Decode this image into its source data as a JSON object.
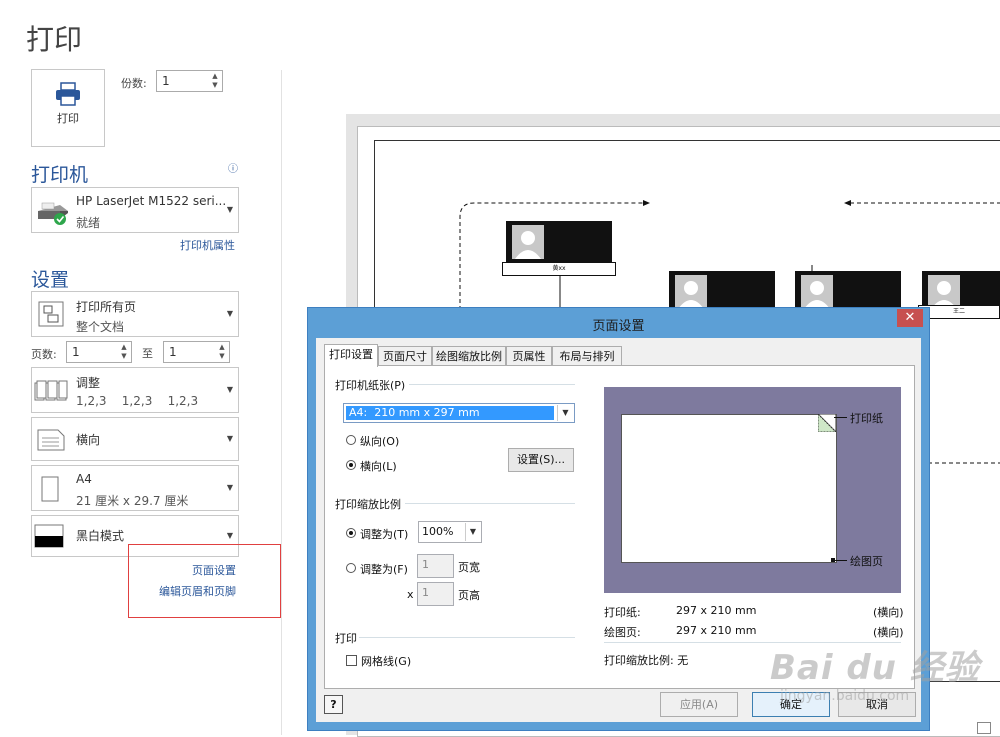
{
  "page": {
    "title": "打印"
  },
  "print_button": {
    "label": "打印"
  },
  "copies": {
    "label": "份数:",
    "value": "1"
  },
  "printer": {
    "heading": "打印机",
    "name": "HP LaserJet M1522 seri...",
    "status": "就绪",
    "properties_link": "打印机属性"
  },
  "settings": {
    "heading": "设置",
    "range": {
      "line1": "打印所有页",
      "line2": "整个文档"
    },
    "pages_label": "页数:",
    "pages_from": "1",
    "pages_to_label": "至",
    "pages_to": "1",
    "collate": {
      "line1": "调整",
      "line2": "1,2,3    1,2,3    1,2,3"
    },
    "orientation": {
      "line1": "横向"
    },
    "paper": {
      "line1": "A4",
      "line2": "21 厘米 x 29.7 厘米"
    },
    "color": {
      "line1": "黑白模式"
    },
    "page_setup_link": "页面设置",
    "header_footer_link": "编辑页眉和页脚"
  },
  "preview": {
    "node_top_name": "黄xx",
    "node_right_name": "王二"
  },
  "dialog": {
    "title": "页面设置",
    "close": "✕",
    "tabs": [
      "打印设置",
      "页面尺寸",
      "绘图缩放比例",
      "页属性",
      "布局与排列"
    ],
    "paper_group": "打印机纸张(P)",
    "paper_value": "A4:  210 mm x 297 mm",
    "portrait": "纵向(O)",
    "landscape": "横向(L)",
    "setup_button": "设置(S)...",
    "zoom_group": "打印缩放比例",
    "fit_to": "调整为(T)",
    "fit_value": "100%",
    "fit_pages": "调整为(F)",
    "pages_wide_value": "1",
    "pages_wide_label": "页宽",
    "x_label": "x",
    "pages_high_value": "1",
    "pages_high_label": "页高",
    "print_group": "打印",
    "gridlines": "网格线(G)",
    "preview_paper_label": "打印纸",
    "preview_drawing_label": "绘图页",
    "info": {
      "paper_label": "打印纸:",
      "paper_size": "297 x 210 mm",
      "paper_orient": "(横向)",
      "drawing_label": "绘图页:",
      "drawing_size": "297 x 210 mm",
      "drawing_orient": "(横向)",
      "scale_text": "打印缩放比例: 无"
    },
    "help": "?",
    "apply": "应用(A)",
    "ok": "确定",
    "cancel": "取消"
  },
  "watermark": {
    "logo": "Bai du 经验",
    "url": "jingyan.baidu.com"
  }
}
